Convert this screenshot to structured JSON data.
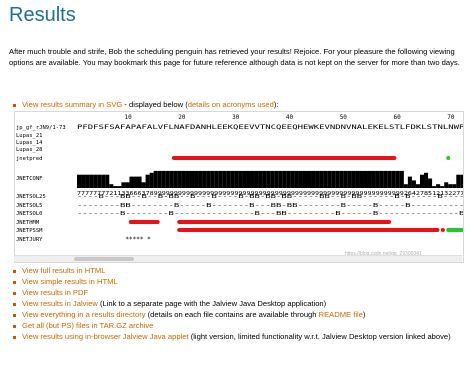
{
  "page": {
    "title": "Results",
    "intro": "After much trouble and strife, Bob the scheduling penguin has retrieved your results! Rejoice. For your pleasure the following viewing options are available. You may bookmark this page for future reference although data is not kept on the server for more than two days."
  },
  "svg_line": {
    "link": "View results summary in SVG",
    "middle": " - displayed below (",
    "acronyms": "details on acronyms used",
    "end": "):"
  },
  "alignment": {
    "ruler": [
      "10",
      "20",
      "30",
      "40",
      "50",
      "60",
      "70"
    ],
    "sequence": "PFDFSFSAFAPAFALVFLNAFDANHLEEKQEEVVTNCQEEQHEWKEVNDNVNALEKELSTLFDKLSTNLNWP",
    "row_labels": [
      "jp_gf_rJN9/1-73",
      "Lupas_21",
      "Lupas_14",
      "Lupas_28",
      "jnetpred",
      "JNETCONF",
      "JNETSOL25",
      "JNETSOL5",
      "JNETSOL0",
      "JNETHMM",
      "JNETPSSM",
      "JNETJURY"
    ],
    "conf_digits": "77777777211336663789999999999999999999999999999999999999999999999999999999999999926427851213227777",
    "sol25": "----B---BB--B--B-BB--B---B----B-BB-BB-BB-----BB--B-BB------B-B-----B----B--B",
    "sol5": "--------BB--------B-----B-------B---BB-BB--------B-----B-----B----------B---",
    "sol0": "--------B--------B---------------B---BB---------B------B---------------B----",
    "jury": "*****     *"
  },
  "links": [
    {
      "link": "View full results in HTML",
      "rest": ""
    },
    {
      "link": "View simple results in HTML",
      "rest": ""
    },
    {
      "link": "View results in PDF",
      "rest": ""
    },
    {
      "link": "View results in Jalview",
      "rest": " (Link to a separate page with the Jalview Java Desktop application)"
    },
    {
      "link": "View everything in a results directory",
      "rest": " (details on each file contains are available through ",
      "link2": "README file",
      "rest2": ")"
    },
    {
      "link": "Get all (but PS) files in TAR.GZ archive",
      "rest": ""
    },
    {
      "link": "View results using in-browser Jalview Java applet",
      "rest": " (light version, limited functionality w.r.t. Jalview Desktop version linked above)"
    }
  ],
  "watermark": "https://blog.csdn.net/qq_29300341",
  "colors": {
    "title": "#1f6f9a",
    "link": "#cc6600",
    "helix": "#ee1111",
    "strand": "#22cc22",
    "bar": "#000000"
  }
}
